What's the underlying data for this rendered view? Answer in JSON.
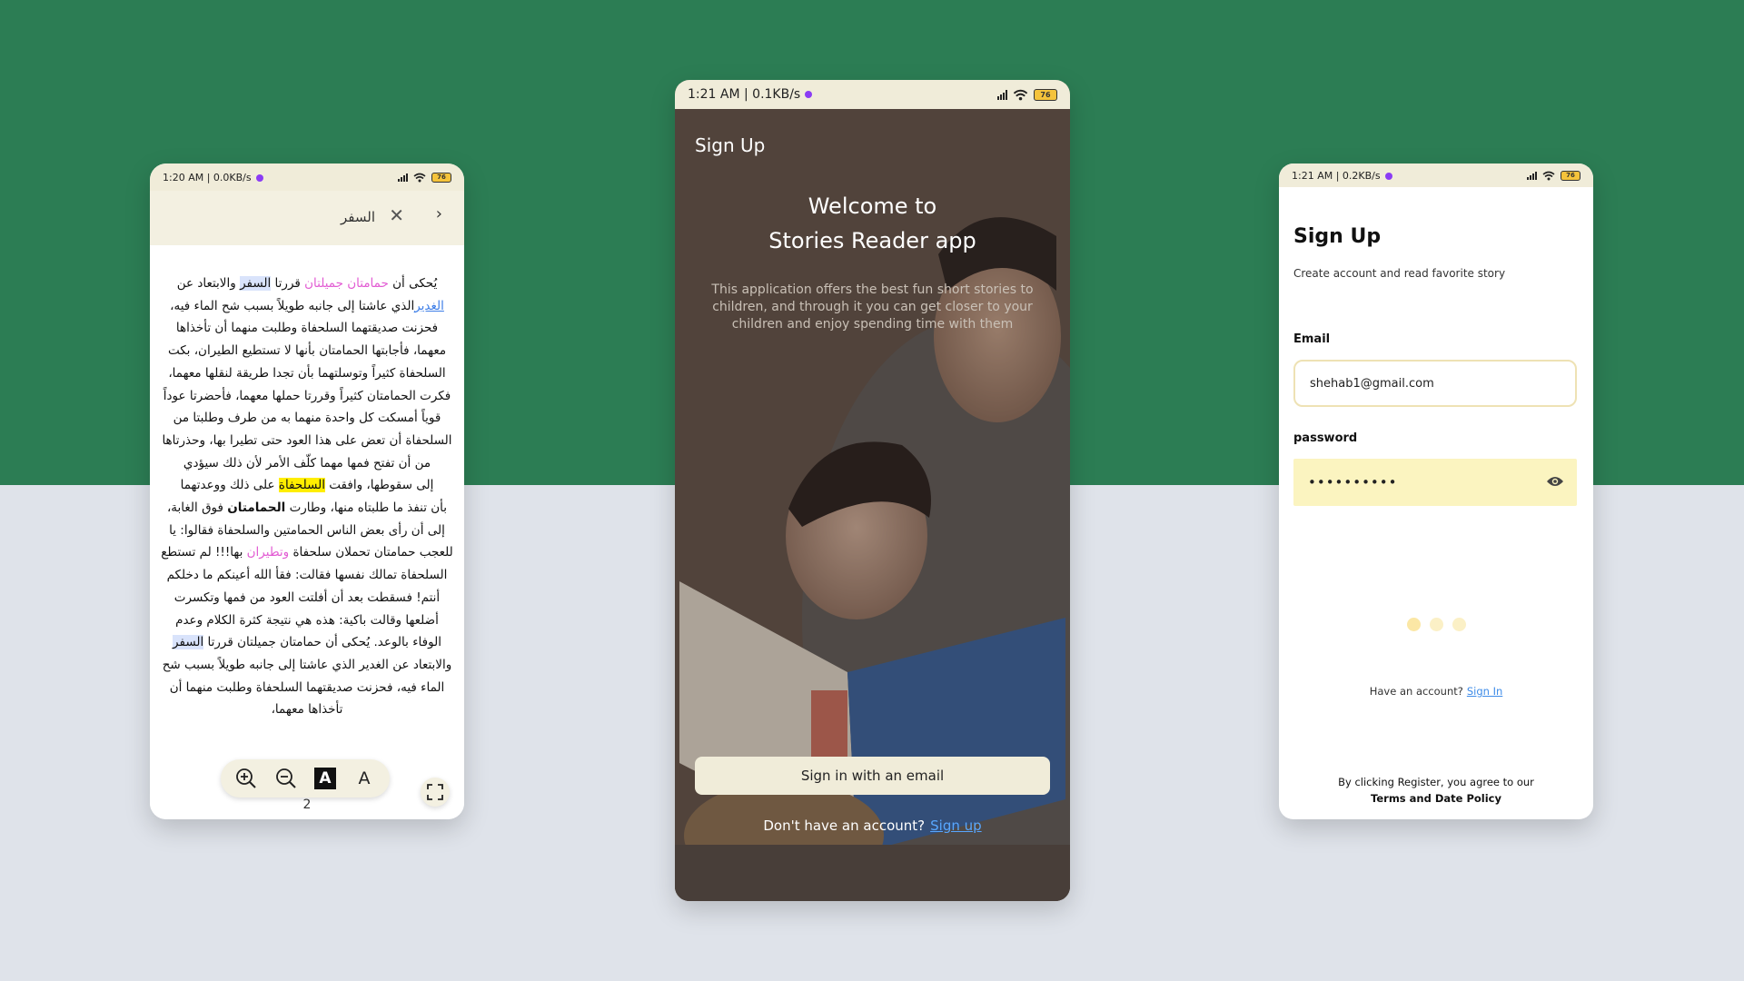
{
  "phone1": {
    "status": {
      "time": "1:20 AM | 0.0KB/s",
      "battery": "76"
    },
    "search": {
      "query": "السفر"
    },
    "story": {
      "l1_a": "يُحكى أن ",
      "l1_b": "حمامتان جميلتان",
      "l1_c": " قررتا ",
      "l1_d": "السفر",
      "l1_e": " والابتعاد عن",
      "l2_a": "الغدير",
      "l2_b": "الذي عاشتا إلى جانبه طويلاً بسبب شح الماء فيه،",
      "l3": "فحزنت صديقتهما السلحفاة وطلبت منهما أن تأخذاها",
      "l4": "معهما، فأجابتها الحمامتان بأنها لا تستطيع الطيران، بكت",
      "l5": "السلحفاة كثيراً وتوسلتهما بأن تجدا طريقة لنقلها معهما،",
      "l6": "فكرت الحمامتان كثيراً وقررتا حملها معهما، فأحضرتا عوداً",
      "l7": "قوياً أمسكت كل واحدة منهما به من طرف وطلبتا من",
      "l8": "السلحفاة أن تعض على هذا العود حتى تطيرا بها، وحذرتاها",
      "l9": "من أن تفتح فمها مهما كلّف الأمر لأن ذلك سيؤدي",
      "l10_a": "إلى سقوطها، وافقت ",
      "l10_b": "السلحفاة",
      "l10_c": " على ذلك ووعدتهما",
      "l11_a": "بأن تنفذ ما طلبتاه منها، وطارت ",
      "l11_b": "الحمامتان",
      "l11_c": " فوق الغابة،",
      "l12": "إلى أن رأى بعض الناس الحمامتين والسلحفاة فقالوا: يا",
      "l13_a": "للعجب حمامتان تحملان سلحفاة ",
      "l13_b": "وتطيران",
      "l13_c": " بها!!! لم تستطع",
      "l14": "السلحفاة تمالك نفسها فقالت: فقأ الله أعينكم ما دخلكم",
      "l15": "أنتم! فسقطت بعد أن أفلتت العود من فمها وتكسرت",
      "l16": "أضلعها وقالت باكية: هذه هي نتيجة كثرة الكلام وعدم",
      "l17_a": "الوفاء بالوعد. يُحكى أن حمامتان جميلتان قررتا ",
      "l17_b": "السفر",
      "l18": "والابتعاد عن الغدير الذي عاشتا إلى جانبه طويلاً بسبب شح",
      "l19": "الماء فيه، فحزنت صديقتهما السلحفاة وطلبت منهما أن",
      "l20": "تأخذاها معهما،"
    },
    "toolbar": {
      "bold_a": "A",
      "plain_a": "A"
    },
    "page_number": "2"
  },
  "phone2": {
    "status": {
      "time": "1:21 AM | 0.1KB/s",
      "battery": "76"
    },
    "title": "Sign Up",
    "welcome_line1": "Welcome to",
    "welcome_line2": "Stories Reader app",
    "description": "This application offers the best fun short stories to children, and through it you can get closer to your children and enjoy spending time with them",
    "email_button": "Sign in with an email",
    "no_account": "Don't have an account?",
    "signup_link": "Sign up"
  },
  "phone3": {
    "status": {
      "time": "1:21 AM | 0.2KB/s",
      "battery": "76"
    },
    "title": "Sign Up",
    "subtitle": "Create account and read favorite story",
    "email_label": "Email",
    "email_value": "shehab1@gmail.com",
    "password_label": "password",
    "password_value": "••••••••••",
    "have_account": "Have an account?",
    "signin_link": "Sign In",
    "terms_line1": "By clicking Register, you agree to our",
    "terms_line2": "Terms and Date Policy"
  },
  "colors": {
    "green": "#2c7d54",
    "cream": "#f0ecd9",
    "link": "#3d8be8",
    "pink": "#e25bd3"
  }
}
